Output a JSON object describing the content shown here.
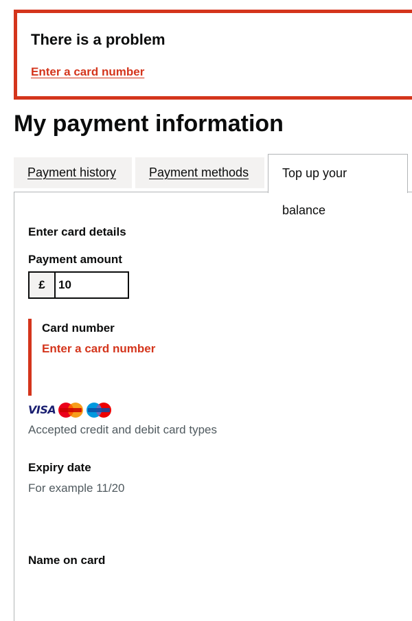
{
  "error_summary": {
    "title": "There is a problem",
    "link": "Enter a card number"
  },
  "page_title": "My payment information",
  "tabs": [
    {
      "label": "Payment history"
    },
    {
      "label": "Payment methods"
    },
    {
      "label": "Top up your balance"
    }
  ],
  "form": {
    "section_heading": "Enter card details",
    "amount": {
      "label": "Payment amount",
      "prefix": "£",
      "value": "10"
    },
    "card_number": {
      "label": "Card number",
      "error": "Enter a card number"
    },
    "card_types": {
      "logos": [
        "visa-logo",
        "mastercard-logo",
        "maestro-logo"
      ],
      "hint": "Accepted credit and debit card types"
    },
    "expiry": {
      "label": "Expiry date",
      "hint": "For example 11/20"
    },
    "name_on_card": {
      "label": "Name on card"
    }
  },
  "colors": {
    "error": "#d4351c",
    "text": "#0b0c0c",
    "hint": "#505a5f",
    "tab_bg": "#f3f2f1",
    "border": "#b1b4b6"
  }
}
